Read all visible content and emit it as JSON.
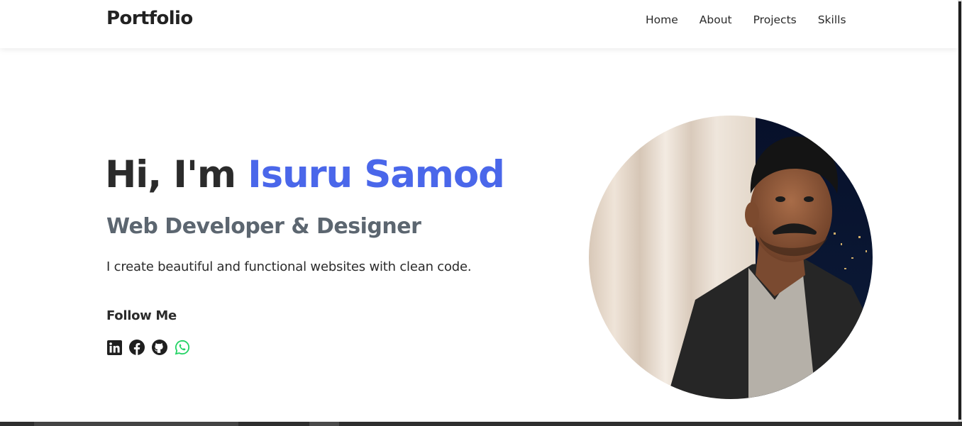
{
  "navbar": {
    "brand": "Portfolio",
    "links": [
      "Home",
      "About",
      "Projects",
      "Skills"
    ]
  },
  "hero": {
    "greeting": "Hi, I'm",
    "name": "Isuru Samod",
    "subtitle": "Web Developer & Designer",
    "description": "I create beautiful and functional websites with clean code.",
    "follow_label": "Follow Me"
  },
  "socials": [
    {
      "icon": "linkedin-icon",
      "color": "#1f1f1f"
    },
    {
      "icon": "facebook-icon",
      "color": "#1f1f1f"
    },
    {
      "icon": "github-icon",
      "color": "#1f1f1f"
    },
    {
      "icon": "whatsapp-icon",
      "color": "#25d366"
    }
  ],
  "colors": {
    "accent": "#4a67ea",
    "text": "#2b2b2b",
    "subtitle": "#5c6670"
  }
}
